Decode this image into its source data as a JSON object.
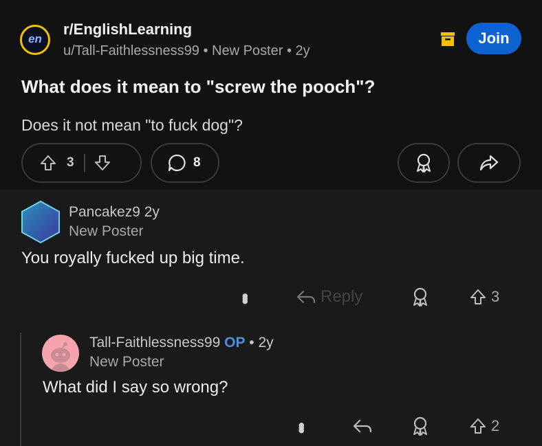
{
  "post": {
    "subreddit": "r/EnglishLearning",
    "subreddit_avatar_text": "en",
    "author": "u/Tall-Faithlessness99",
    "author_flair": "New Poster",
    "age": "2y",
    "join_label": "Join",
    "title": "What does it mean to \"screw the pooch\"?",
    "body": "Does it not mean \"to fuck dog\"?",
    "upvotes": "3",
    "comment_count": "8"
  },
  "comments": [
    {
      "author": "Pancakez9",
      "age": "2y",
      "flair": "New Poster",
      "text": "You royally fucked up big time.",
      "reply_label": "Reply",
      "score": "3"
    },
    {
      "author": "Tall-Faithlessness99",
      "op_badge": "OP",
      "age": "2y",
      "flair": "New Poster",
      "text": "What did I say so wrong?",
      "score": "2"
    }
  ],
  "colors": {
    "background": "#121212",
    "comment_background": "#1a1a1b",
    "join_button": "#0d62d1",
    "op_badge": "#4a90e2",
    "archive_icon": "#f2c200"
  },
  "icons": [
    "subreddit-avatar",
    "archive-icon",
    "upvote-icon",
    "downvote-icon",
    "comment-icon",
    "award-icon",
    "share-icon",
    "more-icon",
    "reply-icon",
    "snoo-avatar"
  ]
}
